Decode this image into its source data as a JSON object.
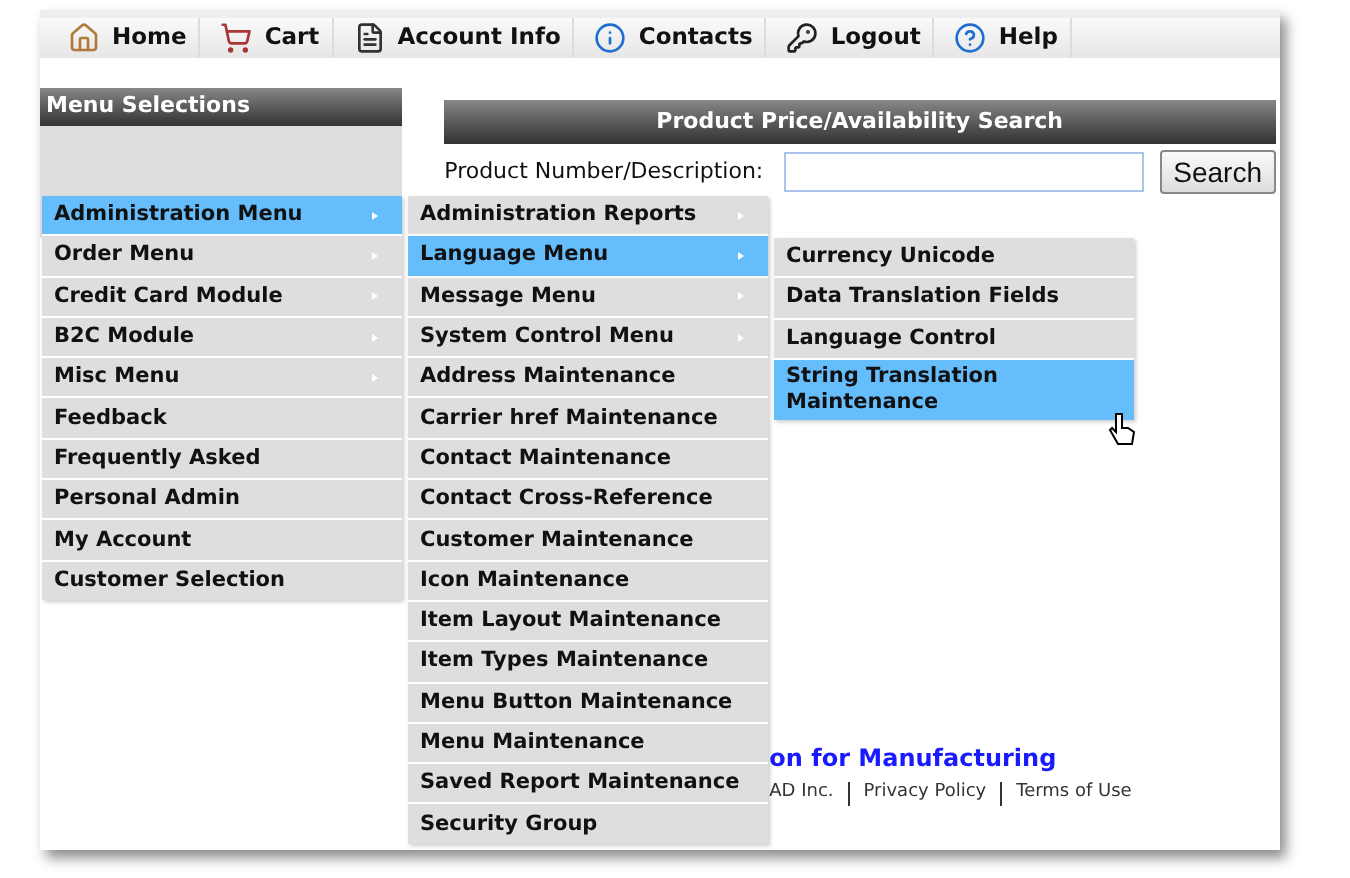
{
  "nav": [
    {
      "label": "Home"
    },
    {
      "label": "Cart"
    },
    {
      "label": "Account Info"
    },
    {
      "label": "Contacts"
    },
    {
      "label": "Logout"
    },
    {
      "label": "Help"
    }
  ],
  "sidebar": {
    "title": "Menu Selections"
  },
  "search": {
    "title": "Product Price/Availability Search",
    "label": "Product Number/Description:",
    "button": "Search"
  },
  "menus": [
    {
      "items": [
        {
          "label": "Administration Menu",
          "selected": true,
          "has_submenu": true
        },
        {
          "label": "Order Menu",
          "selected": false,
          "has_submenu": true
        },
        {
          "label": "Credit Card Module",
          "selected": false,
          "has_submenu": true
        },
        {
          "label": "B2C Module",
          "selected": false,
          "has_submenu": true
        },
        {
          "label": "Misc Menu",
          "selected": false,
          "has_submenu": true
        },
        {
          "label": "Feedback",
          "selected": false,
          "has_submenu": false
        },
        {
          "label": "Frequently Asked",
          "selected": false,
          "has_submenu": false
        },
        {
          "label": "Personal Admin",
          "selected": false,
          "has_submenu": false
        },
        {
          "label": "My Account",
          "selected": false,
          "has_submenu": false
        },
        {
          "label": "Customer Selection",
          "selected": false,
          "has_submenu": false
        }
      ]
    },
    {
      "items": [
        {
          "label": "Administration Reports",
          "selected": false,
          "has_submenu": true
        },
        {
          "label": "Language Menu",
          "selected": true,
          "has_submenu": true
        },
        {
          "label": "Message Menu",
          "selected": false,
          "has_submenu": true
        },
        {
          "label": "System Control Menu",
          "selected": false,
          "has_submenu": true
        },
        {
          "label": "Address Maintenance",
          "selected": false,
          "has_submenu": false
        },
        {
          "label": "Carrier href Maintenance",
          "selected": false,
          "has_submenu": false
        },
        {
          "label": "Contact Maintenance",
          "selected": false,
          "has_submenu": false
        },
        {
          "label": "Contact Cross-Reference",
          "selected": false,
          "has_submenu": false
        },
        {
          "label": "Customer Maintenance",
          "selected": false,
          "has_submenu": false
        },
        {
          "label": "Icon Maintenance",
          "selected": false,
          "has_submenu": false
        },
        {
          "label": "Item Layout Maintenance",
          "selected": false,
          "has_submenu": false
        },
        {
          "label": "Item Types Maintenance",
          "selected": false,
          "has_submenu": false
        },
        {
          "label": "Menu Button Maintenance",
          "selected": false,
          "has_submenu": false
        },
        {
          "label": "Menu Maintenance",
          "selected": false,
          "has_submenu": false
        },
        {
          "label": "Saved Report Maintenance",
          "selected": false,
          "has_submenu": false
        },
        {
          "label": "Security Group",
          "selected": false,
          "has_submenu": false
        }
      ]
    },
    {
      "items": [
        {
          "label": "Currency Unicode",
          "selected": false,
          "has_submenu": false
        },
        {
          "label": "Data Translation Fields",
          "selected": false,
          "has_submenu": false
        },
        {
          "label": "Language Control",
          "selected": false,
          "has_submenu": false
        },
        {
          "label": "String Translation Maintenance",
          "selected": true,
          "has_submenu": false
        }
      ]
    }
  ],
  "footer": {
    "title": "on for Manufacturing",
    "links": [
      "AD Inc.",
      "Privacy Policy",
      "Terms of Use"
    ]
  }
}
